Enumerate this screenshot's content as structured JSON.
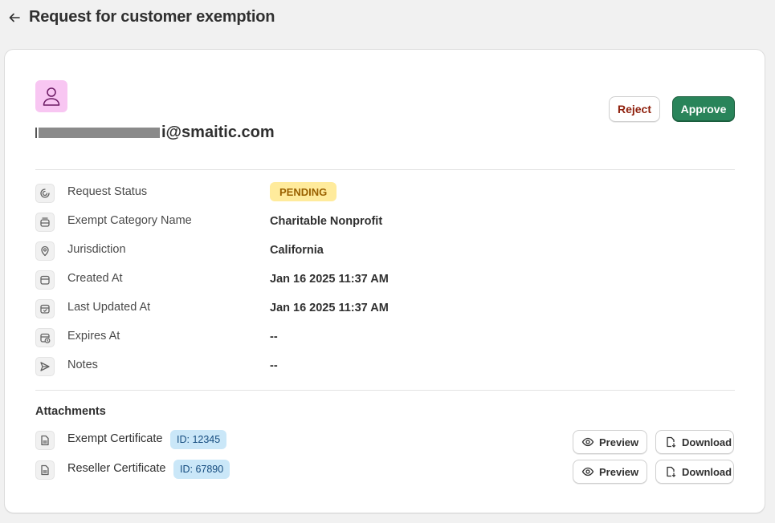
{
  "header": {
    "title": "Request for customer exemption",
    "back_icon": "arrow-left-icon"
  },
  "customer": {
    "avatar_icon": "person-icon",
    "avatar_color": "#f8c6f2",
    "email_visible": "i@smaitic.com"
  },
  "actions": {
    "reject_label": "Reject",
    "approve_label": "Approve",
    "approve_color": "#29845a",
    "reject_text_color": "#8e1f0b"
  },
  "details": [
    {
      "icon": "status-icon",
      "label": "Request Status",
      "value": "PENDING"
    },
    {
      "icon": "category-icon",
      "label": "Exempt Category Name",
      "value": "Charitable Nonprofit"
    },
    {
      "icon": "location-pin-icon",
      "label": "Jurisdiction",
      "value": "California"
    },
    {
      "icon": "calendar-icon",
      "label": "Created At",
      "value": "Jan 16 2025 11:37 AM"
    },
    {
      "icon": "calendar-check-icon",
      "label": "Last Updated At",
      "value": "Jan 16 2025 11:37 AM"
    },
    {
      "icon": "calendar-clock-icon",
      "label": "Expires At",
      "value": "--"
    },
    {
      "icon": "send-icon",
      "label": "Notes",
      "value": "--"
    }
  ],
  "status_colors": {
    "pending_bg": "#ffeb9c",
    "pending_text": "#9a6100"
  },
  "attachments": {
    "title": "Attachments",
    "items": [
      {
        "name": "Exempt Certificate",
        "id_label": "ID: 12345",
        "preview_label": "Preview",
        "download_label": "Download"
      },
      {
        "name": "Reseller Certificate",
        "id_label": "ID: 67890",
        "preview_label": "Preview",
        "download_label": "Download"
      }
    ]
  }
}
